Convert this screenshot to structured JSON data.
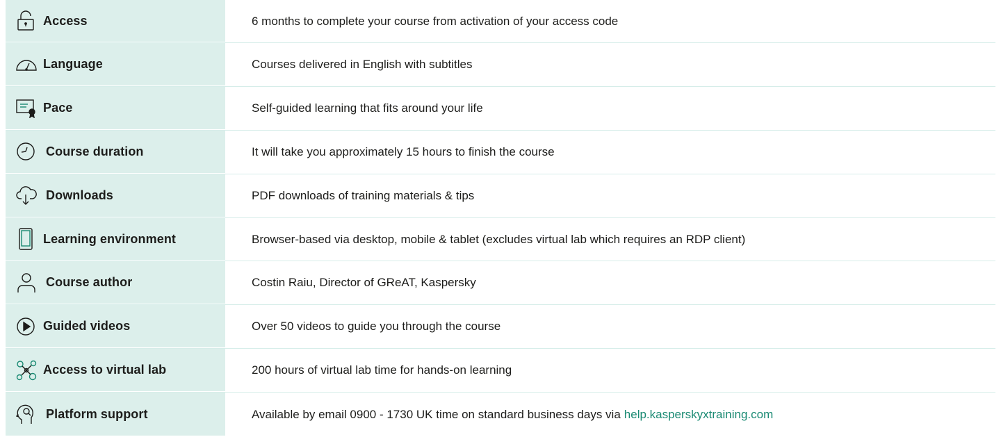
{
  "colors": {
    "label_bg": "#dcefeb",
    "row_divider": "#d6ede9",
    "link": "#1a8a73",
    "text": "#1d1d1b"
  },
  "rows": [
    {
      "icon": "padlock-icon",
      "label": "Access",
      "value": "6 months to complete your course from activation of your access code"
    },
    {
      "icon": "gauge-icon",
      "label": "Language",
      "value": "Courses delivered in English with subtitles"
    },
    {
      "icon": "certificate-icon",
      "label": "Pace",
      "value": "Self-guided learning that fits around your life"
    },
    {
      "icon": "clock-icon",
      "label": "Course duration",
      "value": "It will take you approximately 15 hours to finish the course"
    },
    {
      "icon": "cloud-download-icon",
      "label": "Downloads",
      "value": "PDF downloads of training materials & tips"
    },
    {
      "icon": "mobile-device-icon",
      "label": "Learning environment",
      "value": "Browser-based via desktop, mobile & tablet (excludes virtual lab which requires an RDP client)"
    },
    {
      "icon": "user-icon",
      "label": "Course author",
      "value": "Costin Raiu, Director of GReAT, Kaspersky"
    },
    {
      "icon": "play-icon",
      "label": "Guided videos",
      "value": "Over 50 videos to guide you through the course"
    },
    {
      "icon": "network-nodes-icon",
      "label": "Access to virtual lab",
      "value": "200 hours of virtual lab time for hands-on learning"
    },
    {
      "icon": "head-search-icon",
      "label": "Platform support",
      "value": "Available by email 0900 - 1730 UK time on standard business days via",
      "link": "help.kasperskyxtraining.com"
    }
  ]
}
